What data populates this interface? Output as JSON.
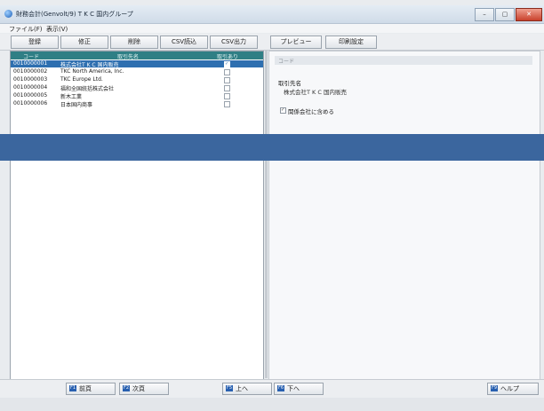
{
  "window": {
    "title": "財務会計(Genvolt/9) T K C 国内グループ",
    "controls": [
      "–",
      "▢",
      "✕"
    ]
  },
  "menu": {
    "items": [
      "ファイル(F)",
      "表示(V)"
    ]
  },
  "toolbar": {
    "buttons": [
      "登録",
      "修正",
      "削除",
      "CSV読込",
      "CSV出力",
      "プレビュー",
      "印刷設定"
    ]
  },
  "grid": {
    "headers": [
      "コード",
      "取引先名",
      "取引あり"
    ],
    "rows": [
      {
        "code": "0010000001",
        "name": "株式会社T K C 国内販売",
        "checked": true,
        "selected": true
      },
      {
        "code": "0010000002",
        "name": "TKC North America, Inc.",
        "checked": false,
        "selected": false
      },
      {
        "code": "0010000003",
        "name": "TKC Europe Ltd.",
        "checked": false,
        "selected": false
      },
      {
        "code": "0010000004",
        "name": "福和全国統括株式会社",
        "checked": false,
        "selected": false
      },
      {
        "code": "0010000005",
        "name": "新木工業",
        "checked": false,
        "selected": false
      },
      {
        "code": "0010000006",
        "name": "日本国内商事",
        "checked": false,
        "selected": false
      }
    ]
  },
  "detail": {
    "strip": "コード",
    "label": "取引先名",
    "value": "株式会社T K C 国内販売",
    "checkbox_label": "関係会社に含める",
    "checkbox_checked": true
  },
  "bottom": {
    "buttons": [
      {
        "key": "F1",
        "label": "前頁"
      },
      {
        "key": "F2",
        "label": "次頁"
      },
      {
        "key": "F5",
        "label": "上へ"
      },
      {
        "key": "F6",
        "label": "下へ"
      },
      {
        "key": "F9",
        "label": "ヘルプ"
      }
    ]
  },
  "colors": {
    "grid_header": "#2f7f85",
    "selected_row": "#2e6fb0",
    "overlay_band": "#3b669e"
  }
}
